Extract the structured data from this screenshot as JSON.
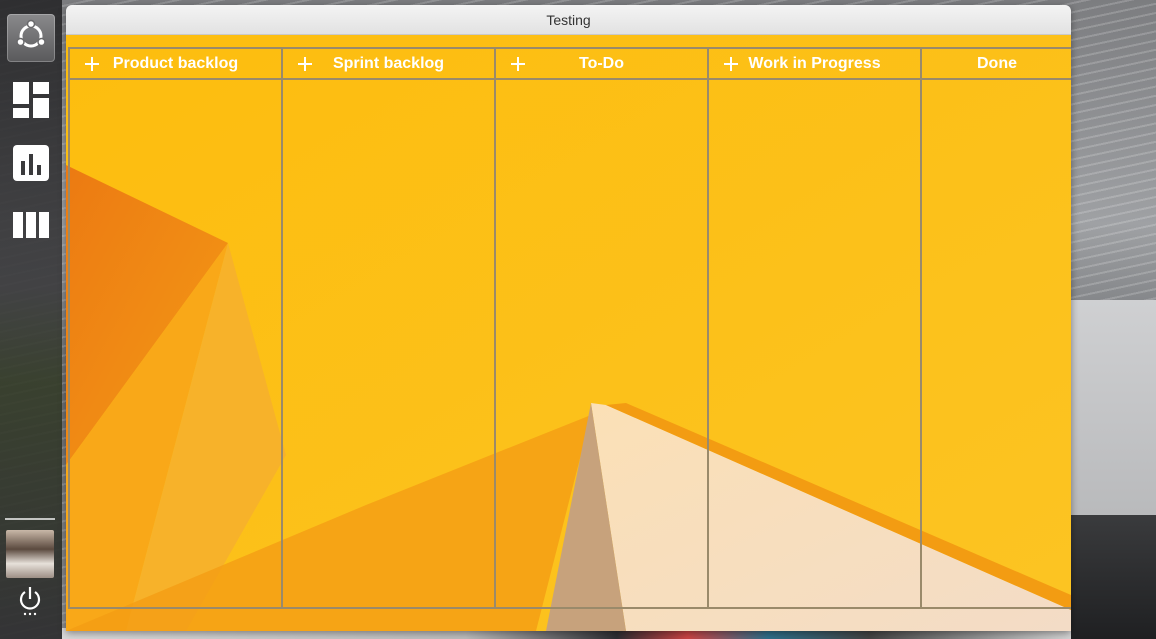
{
  "window": {
    "title": "Testing"
  },
  "board": {
    "columns": [
      {
        "title": "Product backlog",
        "has_add": true
      },
      {
        "title": "Sprint backlog",
        "has_add": true
      },
      {
        "title": "To-Do",
        "has_add": true
      },
      {
        "title": "Work in Progress",
        "has_add": true
      },
      {
        "title": "Done",
        "has_add": false
      }
    ]
  },
  "launcher": {
    "items": [
      {
        "icon": "ubuntu-logo-icon"
      },
      {
        "icon": "dashboard-icon"
      },
      {
        "icon": "bar-chart-icon"
      },
      {
        "icon": "columns-icon"
      }
    ],
    "power_icon": "power-icon"
  },
  "colors": {
    "board_background": "#fcbd12",
    "column_border": "#9a8a6a",
    "header_text": "#ffffff"
  }
}
